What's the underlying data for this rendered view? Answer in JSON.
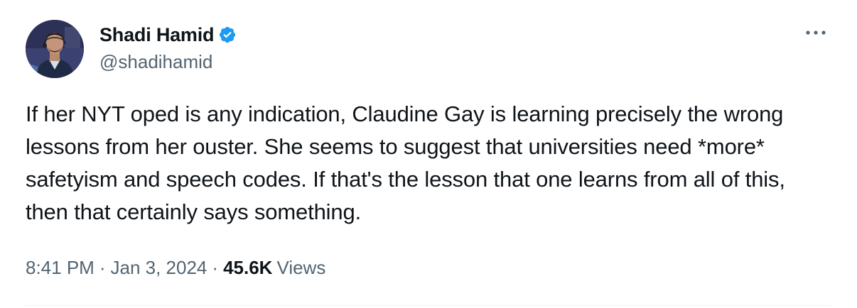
{
  "author": {
    "display_name": "Shadi Hamid",
    "handle": "@shadihamid",
    "verified": true
  },
  "tweet": {
    "text": "If her NYT oped is any indication, Claudine Gay is learning precisely the wrong lessons from her ouster. She seems to suggest that universities need *more* safetyism and speech codes. If that's the lesson that one learns from all of this, then that certainly says something.",
    "time": "8:41 PM",
    "date": "Jan 3, 2024",
    "separator": "·",
    "views_count": "45.6K",
    "views_label": "Views"
  },
  "icons": {
    "verified": "verified-badge-icon",
    "more": "more-options-icon"
  },
  "colors": {
    "verified_blue": "#1d9bf0",
    "text_primary": "#0f1419",
    "text_secondary": "#536471"
  }
}
